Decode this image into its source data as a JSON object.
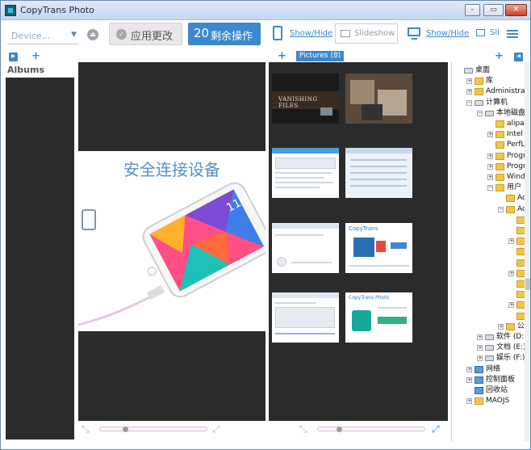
{
  "window": {
    "title": "CopyTrans Photo",
    "controls": [
      "minimize",
      "maximize",
      "close"
    ]
  },
  "toolbar": {
    "device_placeholder": "Device...",
    "apply_label": "应用更改",
    "ops_count": "20",
    "ops_label": "剩余操作",
    "show_hide_1": "Show/Hide",
    "slideshow_label": "Slideshow",
    "show_hide_2": "Show/Hide",
    "sli_text": "Sli",
    "accent_color": "#3c88cd"
  },
  "albums": {
    "title": "Albums"
  },
  "preview": {
    "connect_text": "安全连接设备"
  },
  "photos": {
    "tab_label": "Pictures (8)",
    "count": 8
  },
  "tree": {
    "items": [
      {
        "label": "桌面",
        "icon": "monitor-icon"
      },
      {
        "label": "库",
        "icon": "folder-icon"
      },
      {
        "label": "Administrator",
        "icon": "folder-icon"
      },
      {
        "label": "计算机",
        "icon": "computer-icon"
      },
      {
        "label": "本地磁盘 (C",
        "icon": "drive-icon"
      },
      {
        "label": "alipay",
        "icon": "folder-icon"
      },
      {
        "label": "Intel",
        "icon": "folder-icon"
      },
      {
        "label": "PerfLog",
        "icon": "folder-icon"
      },
      {
        "label": "Program",
        "icon": "folder-icon"
      },
      {
        "label": "Program",
        "icon": "folder-icon"
      },
      {
        "label": "Window",
        "icon": "folder-icon"
      },
      {
        "label": "用户",
        "icon": "folder-icon"
      },
      {
        "label": "Adm",
        "icon": "folder-icon"
      },
      {
        "label": "Adm",
        "icon": "folder-icon"
      },
      {
        "label": "",
        "icon": "folder-icon"
      },
      {
        "label": "",
        "icon": "folder-icon"
      },
      {
        "label": "",
        "icon": "folder-icon"
      },
      {
        "label": "",
        "icon": "folder-icon"
      },
      {
        "label": "",
        "icon": "folder-icon"
      },
      {
        "label": "",
        "icon": "folder-icon"
      },
      {
        "label": "",
        "icon": "folder-icon"
      },
      {
        "label": "",
        "icon": "folder-icon"
      },
      {
        "label": "",
        "icon": "folder-icon"
      },
      {
        "label": "",
        "icon": "folder-icon"
      },
      {
        "label": "公用",
        "icon": "folder-icon"
      },
      {
        "label": "软件 (D:)",
        "icon": "drive-icon"
      },
      {
        "label": "文档 (E:)",
        "icon": "drive-icon"
      },
      {
        "label": "娱乐 (F:)",
        "icon": "drive-icon"
      },
      {
        "label": "网络",
        "icon": "network-icon"
      },
      {
        "label": "控制面板",
        "icon": "control-panel-icon"
      },
      {
        "label": "回收站",
        "icon": "recycle-bin-icon"
      },
      {
        "label": "MAOJS",
        "icon": "folder-icon"
      }
    ]
  },
  "thumbnails": [
    {
      "title": "VANISHING FILES"
    },
    {
      "title": ""
    },
    {
      "title": ""
    },
    {
      "title": ""
    },
    {
      "title": ""
    },
    {
      "title": "CopyTrans"
    },
    {
      "title": ""
    },
    {
      "title": "CopyTrans Photo"
    }
  ]
}
